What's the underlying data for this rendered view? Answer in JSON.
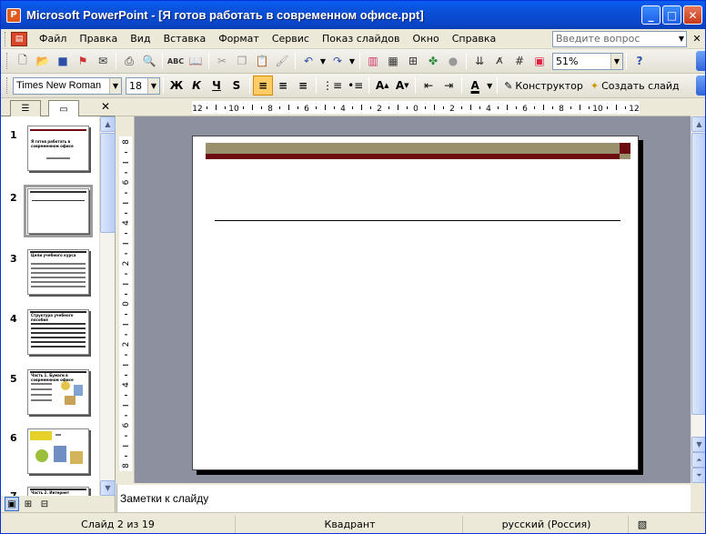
{
  "window": {
    "title": "Microsoft PowerPoint - [Я готов работать в современном офисе.ppt]",
    "app_icon_letter": "P",
    "controls": {
      "minimize": "_",
      "maximize": "□",
      "close": "✕"
    }
  },
  "menubar": {
    "items": [
      "Файл",
      "Правка",
      "Вид",
      "Вставка",
      "Формат",
      "Сервис",
      "Показ слайдов",
      "Окно",
      "Справка"
    ],
    "ask_placeholder": "Введите вопрос",
    "close_glyph": "✕"
  },
  "toolbar_standard": {
    "zoom": "51%"
  },
  "toolbar_formatting": {
    "font_name": "Times New Roman",
    "font_size": "18",
    "bold": "Ж",
    "italic": "К",
    "underline": "Ч",
    "shadow": "S",
    "designer_label": "Конструктор",
    "new_slide_label": "Создать слайд"
  },
  "left_pane": {
    "close_glyph": "✕",
    "slides": [
      {
        "number": "1",
        "title": "Я готов работать в современном офисе"
      },
      {
        "number": "2",
        "title": ""
      },
      {
        "number": "3",
        "title": "Цели учебного курса"
      },
      {
        "number": "4",
        "title": "Структура учебного пособия"
      },
      {
        "number": "5",
        "title": "Часть 1. Бумаги в современном офисе"
      },
      {
        "number": "6",
        "title": ""
      },
      {
        "number": "7",
        "title": "Часть 2. Интернет"
      }
    ],
    "selected_slide": "2"
  },
  "rulers": {
    "horizontal_ticks": [
      "12",
      "10",
      "8",
      "6",
      "4",
      "2",
      "0",
      "2",
      "4",
      "6",
      "8",
      "10",
      "12"
    ],
    "vertical_ticks": [
      "8",
      "6",
      "4",
      "2",
      "0",
      "2",
      "4",
      "6",
      "8"
    ]
  },
  "notes": {
    "placeholder": "Заметки к слайду"
  },
  "statusbar": {
    "slide_info": "Слайд 2 из 19",
    "design": "Квадрант",
    "language": "русский (Россия)"
  },
  "colors": {
    "band_olive": "#99916c",
    "band_maroon": "#6d0a12",
    "editor_bg": "#8c909f"
  }
}
